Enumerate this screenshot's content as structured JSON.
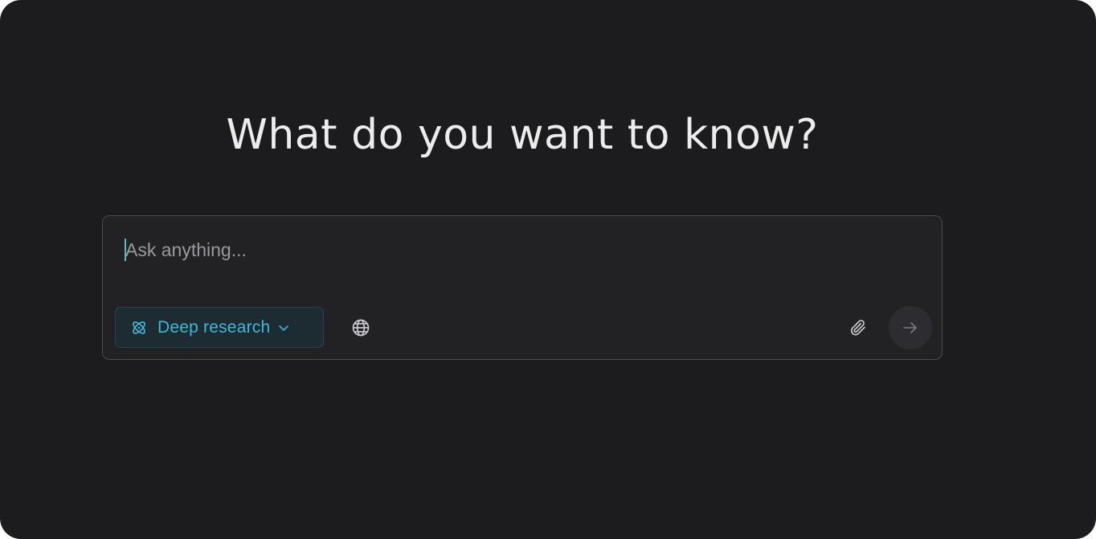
{
  "headline": "What do you want to know?",
  "search": {
    "placeholder": "Ask anything...",
    "value": ""
  },
  "toolbar": {
    "mode_label": "Deep research",
    "mode_icon": "atom-icon",
    "mode_dropdown_icon": "chevron-down-icon",
    "web_icon": "globe-icon",
    "attach_icon": "paperclip-icon",
    "send_icon": "arrow-right-icon"
  },
  "colors": {
    "background": "#1c1b1d",
    "accent": "#41b6d8",
    "composer_border": "#4a4a4e"
  }
}
